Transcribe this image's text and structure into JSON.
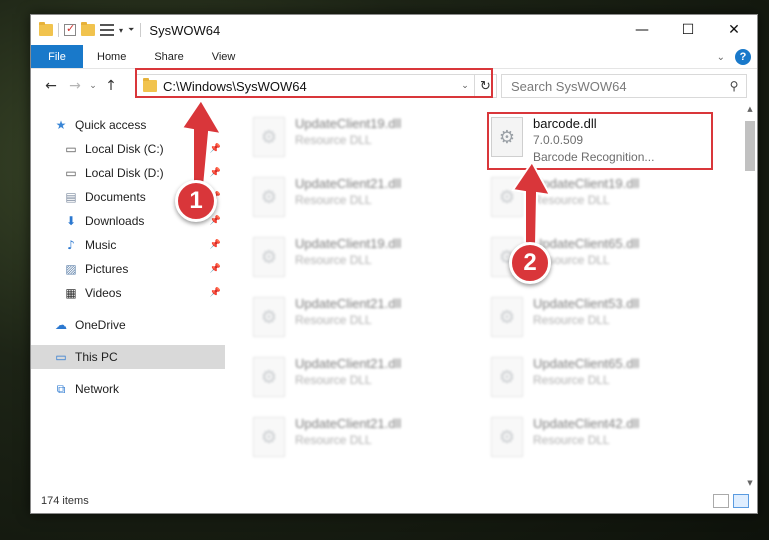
{
  "window": {
    "title": "SysWOW64",
    "minimize_glyph": "—",
    "maximize_glyph": "☐",
    "close_glyph": "✕"
  },
  "ribbon": {
    "tabs": [
      "File",
      "Home",
      "Share",
      "View"
    ],
    "help": "?"
  },
  "nav": {
    "address": "C:\\Windows\\SysWOW64",
    "search_placeholder": "Search SysWOW64"
  },
  "sidebar": {
    "items": [
      {
        "label": "Quick access",
        "icon": "star-icon"
      },
      {
        "label": "Local Disk (C:)",
        "icon": "drive-icon"
      },
      {
        "label": "Local Disk (D:)",
        "icon": "drive-icon"
      },
      {
        "label": "Documents",
        "icon": "documents-icon"
      },
      {
        "label": "Downloads",
        "icon": "downloads-icon"
      },
      {
        "label": "Music",
        "icon": "music-icon"
      },
      {
        "label": "Pictures",
        "icon": "pictures-icon"
      },
      {
        "label": "Videos",
        "icon": "videos-icon"
      },
      {
        "label": "OneDrive",
        "icon": "cloud-icon"
      },
      {
        "label": "This PC",
        "icon": "pc-icon"
      },
      {
        "label": "Network",
        "icon": "network-icon"
      }
    ]
  },
  "files": {
    "highlighted": {
      "name": "barcode.dll",
      "version": "7.0.0.509",
      "description": "Barcode Recognition..."
    },
    "left_column": [
      {
        "name": "UpdateClient19.dll",
        "type": "Resource DLL"
      },
      {
        "name": "UpdateClient21.dll",
        "type": "Resource DLL"
      },
      {
        "name": "UpdateClient19.dll",
        "type": "Resource DLL"
      },
      {
        "name": "UpdateClient21.dll",
        "type": "Resource DLL"
      },
      {
        "name": "UpdateClient21.dll",
        "type": "Resource DLL"
      },
      {
        "name": "UpdateClient21.dll",
        "type": "Resource DLL"
      }
    ],
    "right_column": [
      {
        "name": "UpdateClient19.dll",
        "type": "Resource DLL"
      },
      {
        "name": "UpdateClient65.dll",
        "type": "Resource DLL"
      },
      {
        "name": "UpdateClient53.dll",
        "type": "Resource DLL"
      },
      {
        "name": "UpdateClient65.dll",
        "type": "Resource DLL"
      },
      {
        "name": "UpdateClient42.dll",
        "type": "Resource DLL"
      }
    ]
  },
  "status": {
    "items": "174 items"
  },
  "callouts": {
    "one": "1",
    "two": "2"
  },
  "colors": {
    "accent": "#1979ca",
    "highlight": "#d9363a"
  }
}
